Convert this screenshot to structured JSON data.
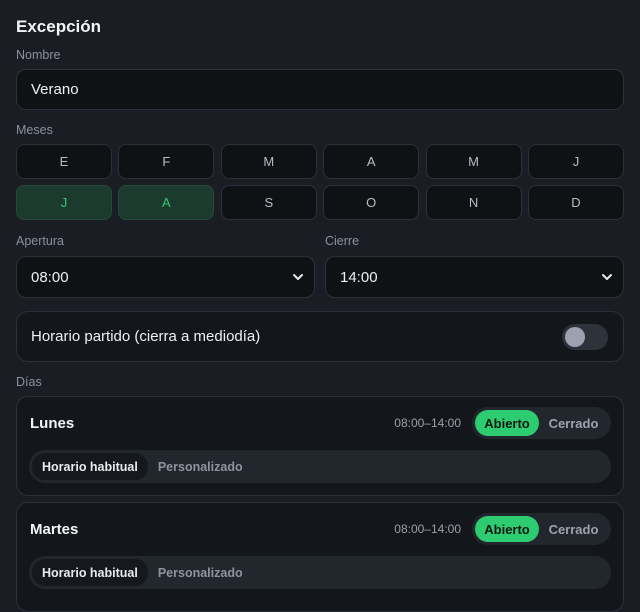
{
  "section_title": "Excepción",
  "name_field": {
    "label": "Nombre",
    "value": "Verano"
  },
  "months": {
    "label": "Meses",
    "items": [
      {
        "letter": "E",
        "selected": false
      },
      {
        "letter": "F",
        "selected": false
      },
      {
        "letter": "M",
        "selected": false
      },
      {
        "letter": "A",
        "selected": false
      },
      {
        "letter": "M",
        "selected": false
      },
      {
        "letter": "J",
        "selected": false
      },
      {
        "letter": "J",
        "selected": true
      },
      {
        "letter": "A",
        "selected": true
      },
      {
        "letter": "S",
        "selected": false
      },
      {
        "letter": "O",
        "selected": false
      },
      {
        "letter": "N",
        "selected": false
      },
      {
        "letter": "D",
        "selected": false
      }
    ]
  },
  "opening": {
    "label": "Apertura",
    "value": "08:00"
  },
  "closing": {
    "label": "Cierre",
    "value": "14:00"
  },
  "split_schedule": {
    "label": "Horario partido (cierra a mediodía)",
    "enabled": false
  },
  "days_label": "Días",
  "days": [
    {
      "name": "Lunes",
      "hours": "08:00–14:00",
      "status_options": [
        "Abierto",
        "Cerrado"
      ],
      "status": "Abierto",
      "mode_options": [
        "Horario habitual",
        "Personalizado"
      ],
      "mode": "Horario habitual"
    },
    {
      "name": "Martes",
      "hours": "08:00–14:00",
      "status_options": [
        "Abierto",
        "Cerrado"
      ],
      "status": "Abierto",
      "mode_options": [
        "Horario habitual",
        "Personalizado"
      ],
      "mode": "Horario habitual"
    }
  ],
  "colors": {
    "accent": "#2ecc71",
    "background": "#1a1d23",
    "selected_month_bg": "#1d3a2e"
  }
}
